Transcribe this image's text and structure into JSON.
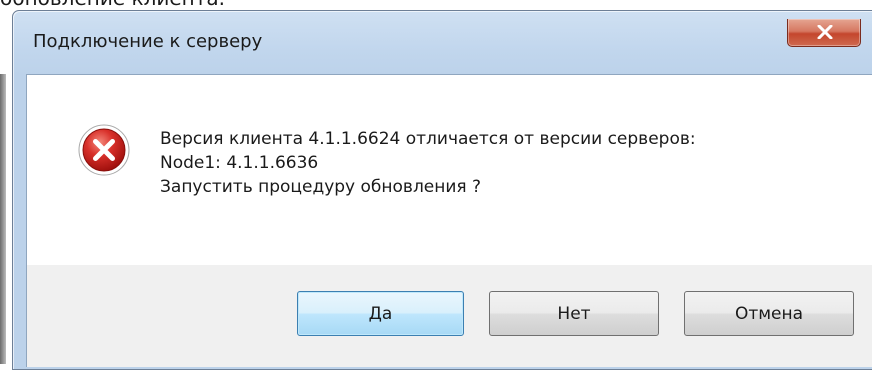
{
  "background": {
    "partial_text": "обновление клиента."
  },
  "dialog": {
    "title": "Подключение к серверу",
    "close_icon": "close-x-icon",
    "status_icon": "error-icon",
    "message_lines": [
      "Версия клиента 4.1.1.6624 отличается от версии серверов:",
      "Node1: 4.1.1.6636",
      "Запустить процедуру обновления ?"
    ],
    "buttons": {
      "yes": "Да",
      "no": "Нет",
      "cancel": "Отмена"
    }
  },
  "colors": {
    "frame": "#bcd2ea",
    "close_button": "#c4462d",
    "error_icon": "#c61a12",
    "default_button_border": "#3c7fb1",
    "footer": "#f0f0f0"
  }
}
